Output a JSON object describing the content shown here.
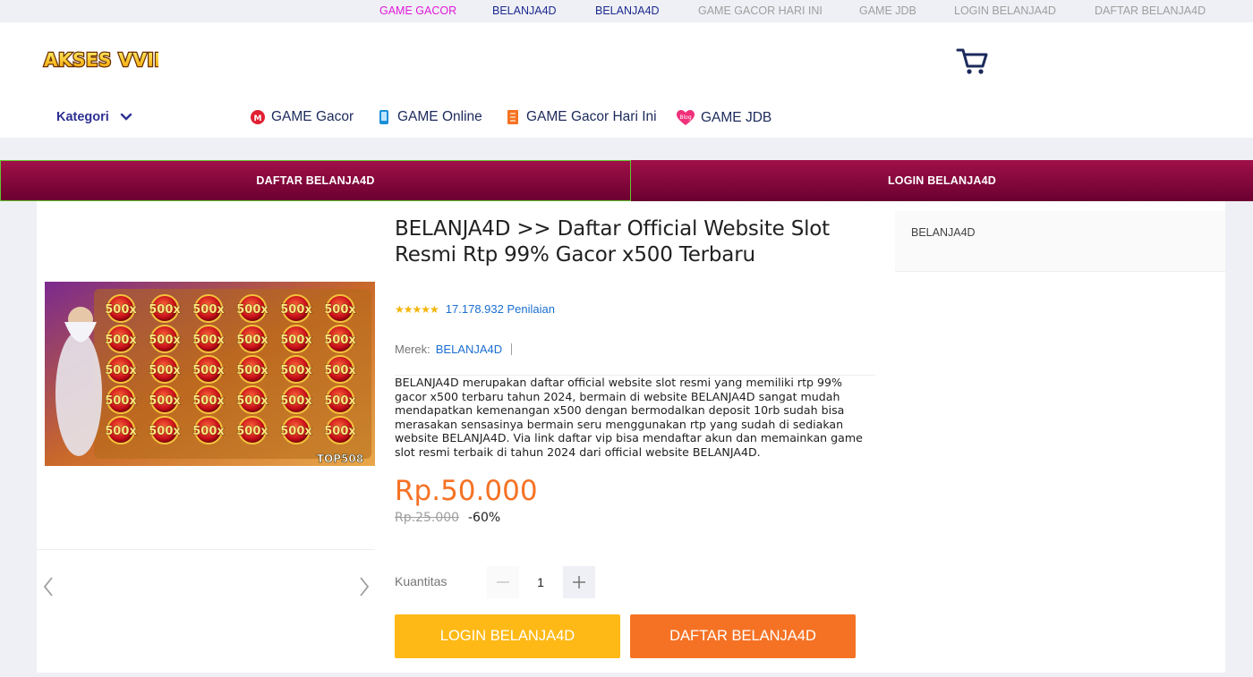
{
  "top_links": [
    {
      "label": "GAME GACOR",
      "color": "#e01ad9"
    },
    {
      "label": "BELANJA4D",
      "color": "#1c2a8f"
    },
    {
      "label": "BELANJA4D",
      "color": "#1c2a8f"
    },
    {
      "label": "GAME GACOR HARI INI",
      "color": "#9e9e9e"
    },
    {
      "label": "GAME JDB",
      "color": "#9e9e9e"
    },
    {
      "label": "LOGIN BELANJA4D",
      "color": "#9e9e9e"
    },
    {
      "label": "DAFTAR BELANJA4D",
      "color": "#9e9e9e"
    }
  ],
  "header": {
    "logo_text": "AKSES VVIP",
    "cart_icon": "shopping-cart-icon",
    "kategori_label": "Kategori",
    "nav_categories": [
      {
        "label": "GAME Gacor",
        "icon": "lazmall-icon"
      },
      {
        "label": "GAME Online",
        "icon": "phone-top-up-icon"
      },
      {
        "label": "GAME Gacor Hari Ini",
        "icon": "voucher-icon"
      },
      {
        "label": "GAME JDB",
        "icon": "blog-heart-icon"
      }
    ]
  },
  "banner": {
    "left_label": "DAFTAR BELANJA4D",
    "right_label": "LOGIN BELANJA4D"
  },
  "product": {
    "title": "BELANJA4D >> Daftar Official Website Slot Resmi Rtp 99% Gacor x500 Terbaru",
    "stars": "★★★★★",
    "rating_count": "17.178.932 Penilaian",
    "brand_label": "Merek:",
    "brand_value": "BELANJA4D",
    "description": "BELANJA4D merupakan daftar official website slot resmi yang memiliki rtp 99% gacor x500 terbaru tahun 2024, bermain di website BELANJA4D sangat mudah mendapatkan kemenangan x500 dengan bermodalkan deposit 10rb sudah bisa merasakan sensasinya bermain seru menggunakan rtp yang sudah di sediakan website BELANJA4D. Via link daftar vip bisa mendaftar akun dan memainkan game slot resmi terbaik di tahun 2024 dari official website BELANJA4D.",
    "price": "Rp.50.000",
    "old_price": "Rp.25.000",
    "discount": "-60%",
    "quantity_label": "Kuantitas",
    "quantity_value": "1",
    "login_button": "LOGIN BELANJA4D",
    "daftar_button": "DAFTAR BELANJA4D",
    "image_tile_label": "500x",
    "image_watermark": "TOP508"
  },
  "sidebar": {
    "label": "BELANJA4D"
  }
}
